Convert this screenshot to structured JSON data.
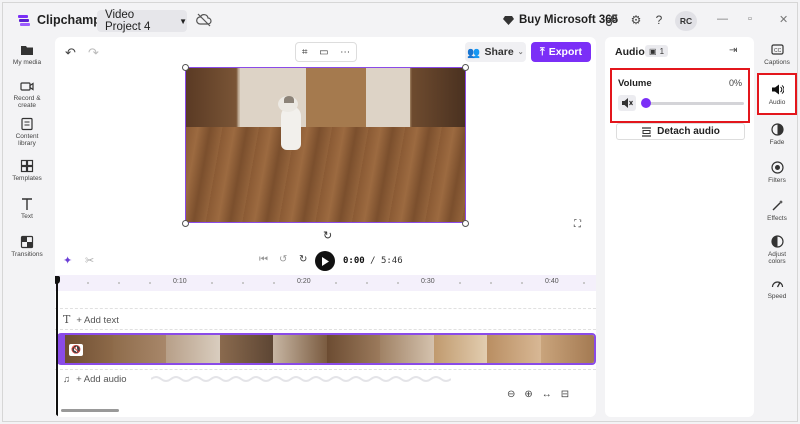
{
  "app": {
    "name": "Clipchamp",
    "project_name": "Video Project 4",
    "buy_label": "Buy Microsoft 365",
    "avatar_initials": "RC",
    "brand_color": "#7b2ff7"
  },
  "left_nav": [
    {
      "label": "My media",
      "icon": "folder-icon"
    },
    {
      "label": "Record & create",
      "icon": "camera-icon"
    },
    {
      "label": "Content library",
      "icon": "library-icon"
    },
    {
      "label": "Templates",
      "icon": "templates-icon"
    },
    {
      "label": "Text",
      "icon": "text-icon"
    },
    {
      "label": "Transitions",
      "icon": "transitions-icon"
    }
  ],
  "editor": {
    "share_label": "Share",
    "export_label": "Export",
    "time_current": "0:00",
    "time_total": "/ 5:46",
    "ruler_ticks": [
      "0:10",
      "0:20",
      "0:30",
      "0:40"
    ],
    "add_text_label": "+ Add text",
    "add_audio_label": "+ Add audio"
  },
  "properties": {
    "title": "Audio",
    "badge_count": "1",
    "volume_label": "Volume",
    "volume_value": "0%",
    "volume_level": 0,
    "detach_label": "Detach audio"
  },
  "right_toolbar": [
    {
      "label": "Captions",
      "icon": "captions-icon"
    },
    {
      "label": "Audio",
      "icon": "speaker-icon",
      "selected": true
    },
    {
      "label": "Fade",
      "icon": "fade-icon"
    },
    {
      "label": "Filters",
      "icon": "filters-icon"
    },
    {
      "label": "Effects",
      "icon": "effects-icon"
    },
    {
      "label": "Adjust colors",
      "icon": "adjust-colors-icon"
    },
    {
      "label": "Speed",
      "icon": "speed-icon"
    }
  ]
}
